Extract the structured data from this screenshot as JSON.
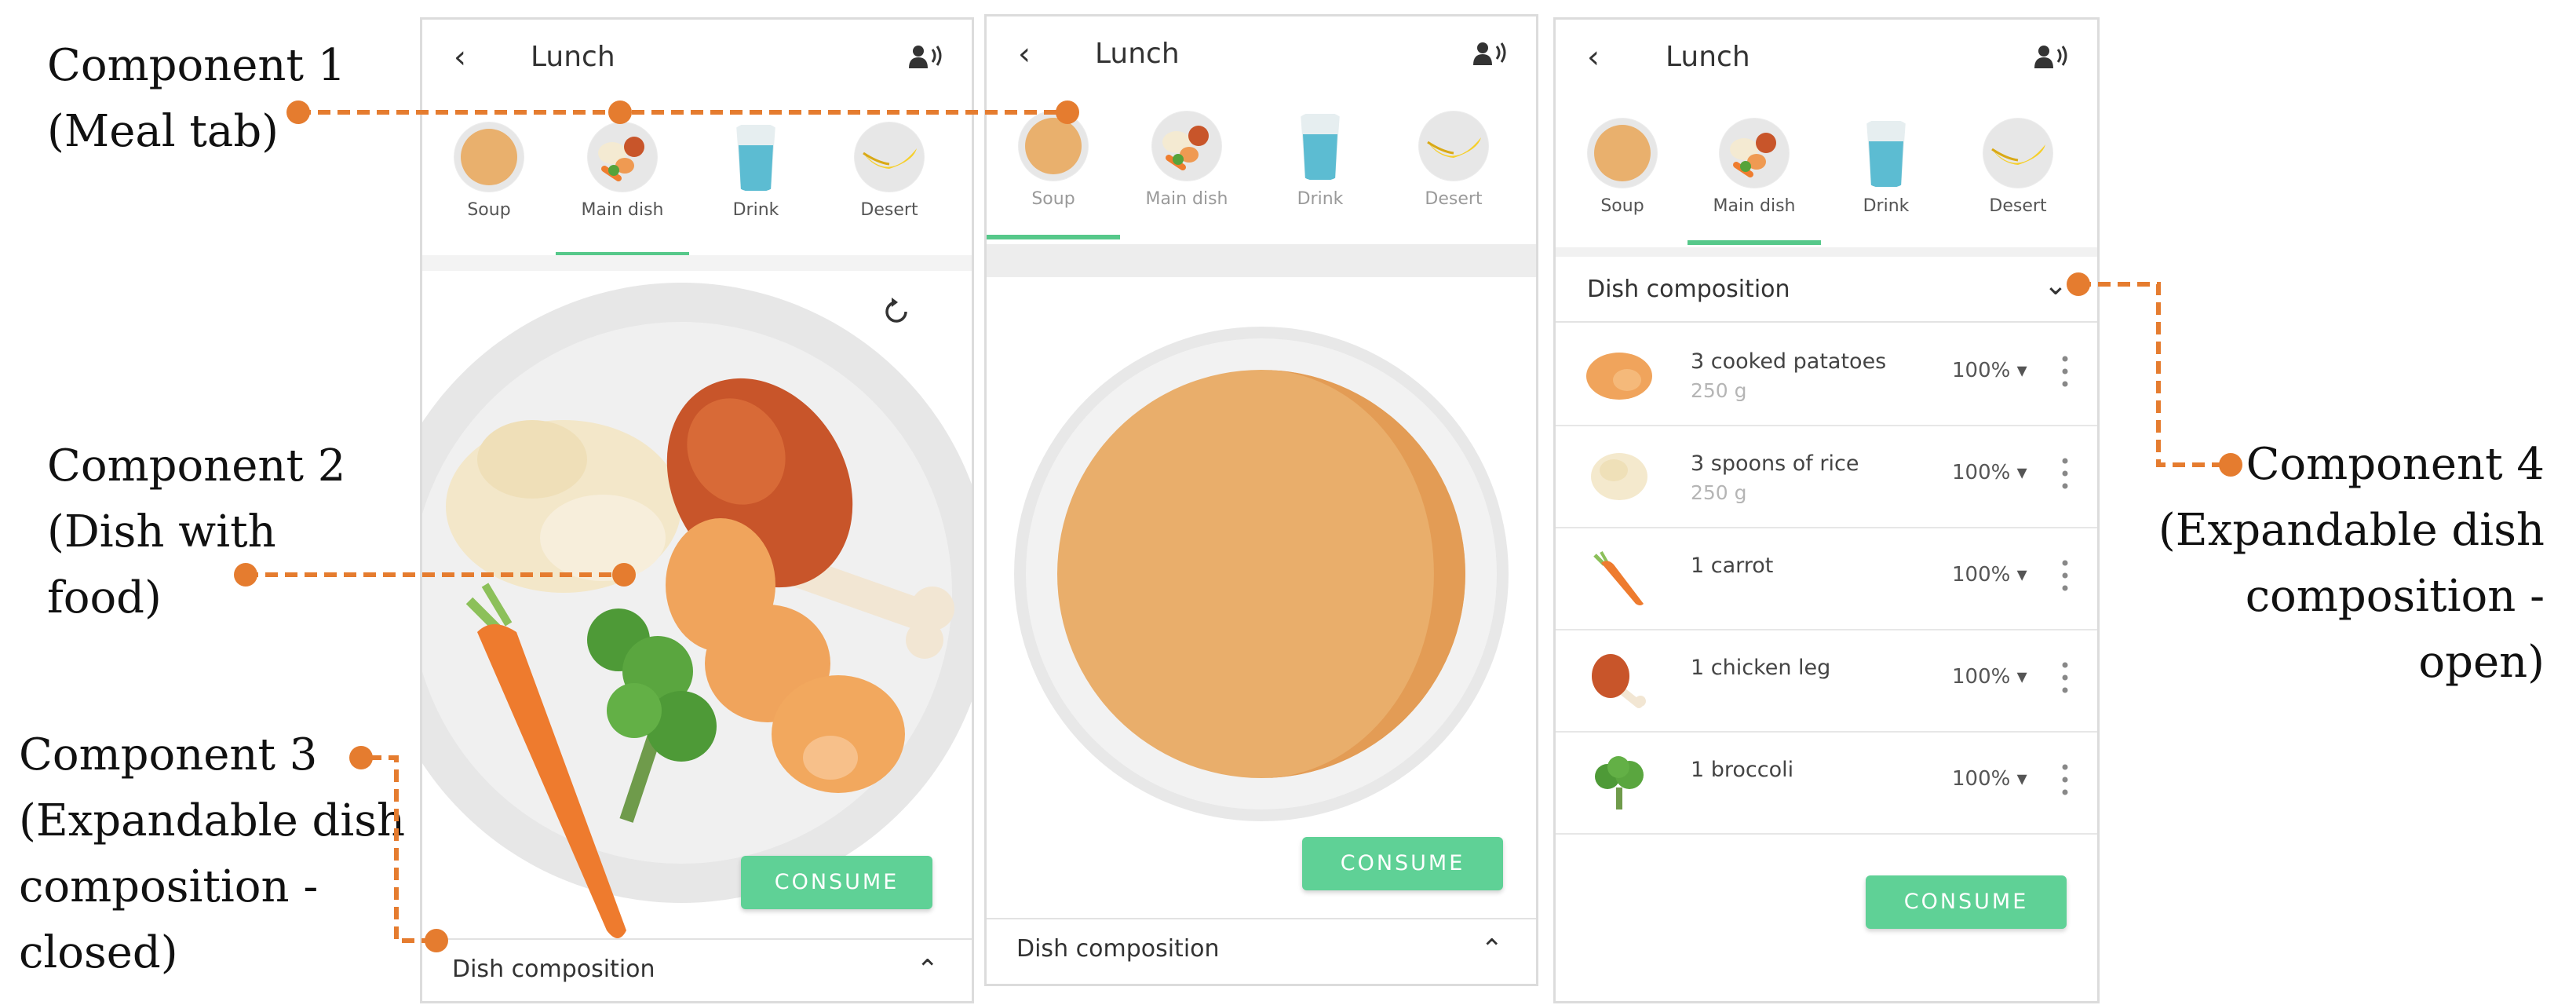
{
  "callouts": {
    "c1": {
      "line1": "Component 1",
      "line2": "(Meal tab)"
    },
    "c2": {
      "line1": "Component 2",
      "line2": "(Dish with",
      "line3": "food)"
    },
    "c3": {
      "line1": "Component 3",
      "line2": "(Expandable dish",
      "line3": "composition -",
      "line4": "closed)"
    },
    "c4": {
      "line1": "Component 4",
      "line2": "(Expandable dish",
      "line3": "composition -",
      "line4": "open)"
    }
  },
  "screens": [
    {
      "title": "Lunch",
      "tabs": [
        {
          "label": "Soup",
          "icon": "soup-icon"
        },
        {
          "label": "Main dish",
          "icon": "main-dish-icon"
        },
        {
          "label": "Drink",
          "icon": "drink-icon"
        },
        {
          "label": "Desert",
          "icon": "banana-icon"
        }
      ],
      "active_tab": "Main dish",
      "consume_label": "CONSUME",
      "dish_composition_label": "Dish composition"
    },
    {
      "title": "Lunch",
      "tabs": [
        {
          "label": "Soup",
          "icon": "soup-icon"
        },
        {
          "label": "Main dish",
          "icon": "main-dish-icon"
        },
        {
          "label": "Drink",
          "icon": "drink-icon"
        },
        {
          "label": "Desert",
          "icon": "banana-icon"
        }
      ],
      "active_tab": "Soup",
      "consume_label": "CONSUME",
      "dish_composition_label": "Dish composition"
    },
    {
      "title": "Lunch",
      "tabs": [
        {
          "label": "Soup",
          "icon": "soup-icon"
        },
        {
          "label": "Main dish",
          "icon": "main-dish-icon"
        },
        {
          "label": "Drink",
          "icon": "drink-icon"
        },
        {
          "label": "Desert",
          "icon": "banana-icon"
        }
      ],
      "active_tab": "Main dish",
      "consume_label": "CONSUME",
      "dish_composition_label": "Dish composition",
      "ingredients": [
        {
          "name": "3 cooked patatoes",
          "weight": "250 g",
          "percent": "100%",
          "icon": "potato-icon"
        },
        {
          "name": "3 spoons of rice",
          "weight": "250 g",
          "percent": "100%",
          "icon": "rice-icon"
        },
        {
          "name": "1 carrot",
          "percent": "100%",
          "icon": "carrot-icon"
        },
        {
          "name": "1 chicken leg",
          "percent": "100%",
          "icon": "chicken-leg-icon"
        },
        {
          "name": "1 broccoli",
          "percent": "100%",
          "icon": "broccoli-icon"
        }
      ]
    }
  ],
  "colors": {
    "accent_green": "#5fd196",
    "connector_orange": "#e57c2f",
    "soup_orange": "#e8ad6c"
  }
}
